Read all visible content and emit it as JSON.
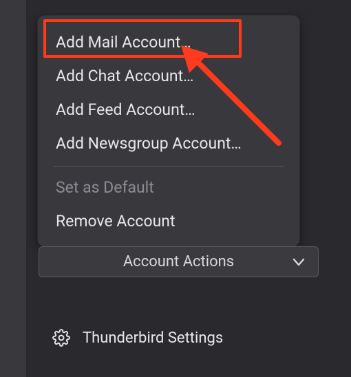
{
  "popup": {
    "items": [
      {
        "label": "Add Mail Account…",
        "enabled": true
      },
      {
        "label": "Add Chat Account…",
        "enabled": true
      },
      {
        "label": "Add Feed Account…",
        "enabled": true
      },
      {
        "label": "Add Newsgroup Account…",
        "enabled": true
      },
      {
        "label": "Set as Default",
        "enabled": false
      },
      {
        "label": "Remove Account",
        "enabled": true
      }
    ]
  },
  "accountActions": {
    "label": "Account Actions"
  },
  "settings": {
    "label": "Thunderbird Settings"
  },
  "annotation": {
    "highlight_target": "add-mail-account",
    "arrow_color": "#ff3b1f"
  }
}
